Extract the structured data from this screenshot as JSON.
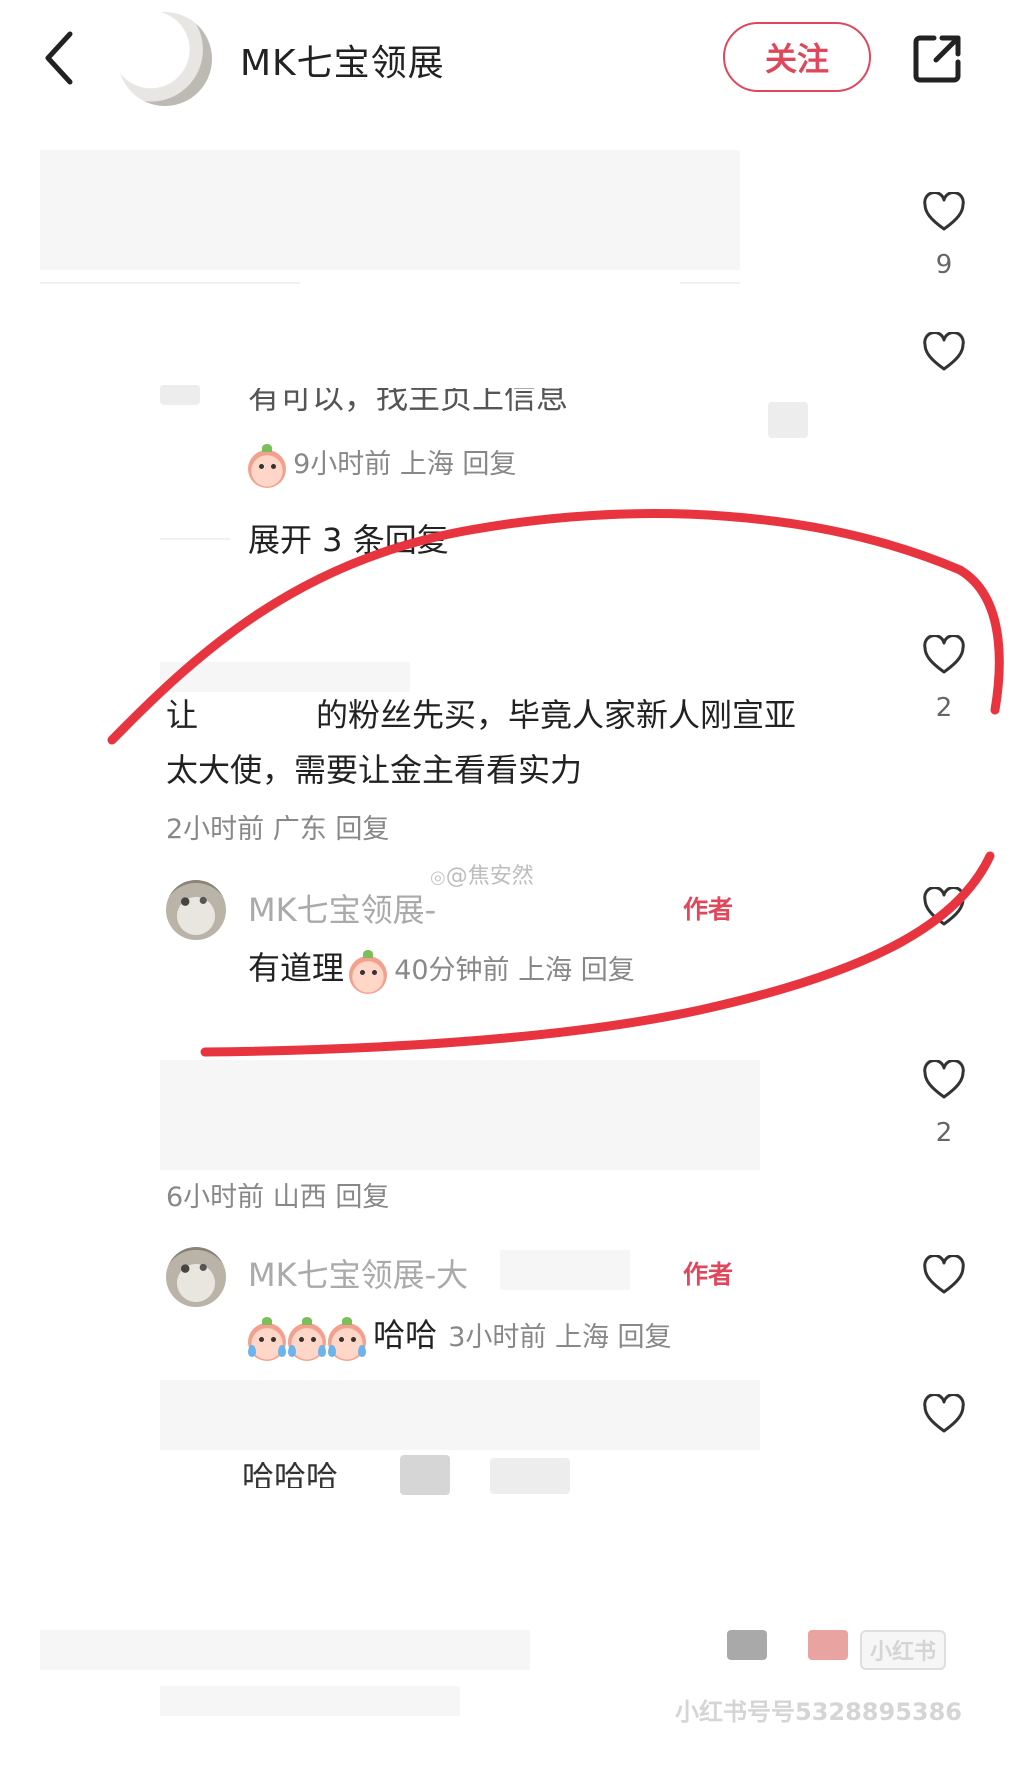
{
  "header": {
    "title": "MK七宝领展",
    "follow_label": "关注"
  },
  "likes": [
    {
      "count": "9"
    },
    {
      "count": ""
    },
    {
      "count": "2"
    },
    {
      "count": ""
    },
    {
      "count": "2"
    },
    {
      "count": ""
    },
    {
      "count": ""
    }
  ],
  "comments": {
    "c1": {
      "partial_text": "有可以，找主页上信息",
      "meta": "9小时前 上海 回复",
      "expand_label": "展开 3 条回复"
    },
    "c2": {
      "line1_start": "让",
      "line1_rest": "的粉丝先买，毕竟人家新人刚宣亚",
      "line2": "太大使，需要让金主看看实力",
      "meta": "2小时前 广东 回复",
      "reply": {
        "name": "MK七宝领展-",
        "badge": "作者",
        "text": "有道理",
        "meta": "40分钟前 上海 回复"
      }
    },
    "c3": {
      "meta": "6小时前 山西 回复",
      "reply": {
        "name": "MK七宝领展-大",
        "badge": "作者",
        "text": "哈哈",
        "meta": "3小时前 上海 回复"
      }
    },
    "c4": {
      "partial_text": "哈哈哈"
    }
  },
  "watermarks": {
    "weibo": "@焦安然",
    "bottom_logo": "小红书",
    "bottom_id": "小红书号号5328895386"
  },
  "colors": {
    "accent": "#e0475b",
    "annotation": "#e8343f"
  }
}
